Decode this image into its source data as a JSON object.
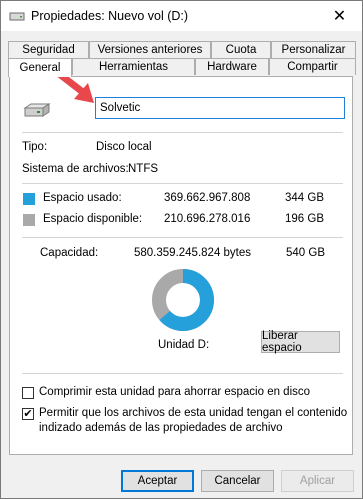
{
  "window": {
    "title": "Propiedades: Nuevo vol (D:)",
    "close_glyph": "✕"
  },
  "tabs": {
    "row1": [
      "Seguridad",
      "Versiones anteriores",
      "Cuota",
      "Personalizar"
    ],
    "row2": [
      "General",
      "Herramientas",
      "Hardware",
      "Compartir"
    ],
    "active": "General"
  },
  "general": {
    "volume_name": "Solvetic",
    "type_label": "Tipo:",
    "type_value": "Disco local",
    "fs_label": "Sistema de archivos:",
    "fs_value": "NTFS",
    "used_label": "Espacio usado:",
    "used_bytes": "369.662.967.808",
    "used_gb": "344 GB",
    "free_label": "Espacio disponible:",
    "free_bytes": "210.696.278.016",
    "free_gb": "196 GB",
    "capacity_label": "Capacidad:",
    "capacity_bytes": "580.359.245.824 bytes",
    "capacity_gb": "540 GB",
    "drive_label": "Unidad D:",
    "cleanup_button": "Liberar espacio",
    "compress_label": "Comprimir esta unidad para ahorrar espacio en disco",
    "compress_checked": false,
    "index_label_line1": "Permitir que los archivos de esta unidad tengan el contenido",
    "index_label_line2": "indizado además de las propiedades de archivo",
    "index_checked": true
  },
  "footer": {
    "ok": "Aceptar",
    "cancel": "Cancelar",
    "apply": "Aplicar"
  },
  "colors": {
    "used": "#26a0da",
    "free": "#a9a9a9",
    "accent": "#0078d7",
    "arrow": "#e8474c"
  },
  "chart_data": {
    "type": "pie",
    "categories": [
      "Espacio usado",
      "Espacio disponible"
    ],
    "values": [
      369662967808,
      210696278016
    ]
  }
}
